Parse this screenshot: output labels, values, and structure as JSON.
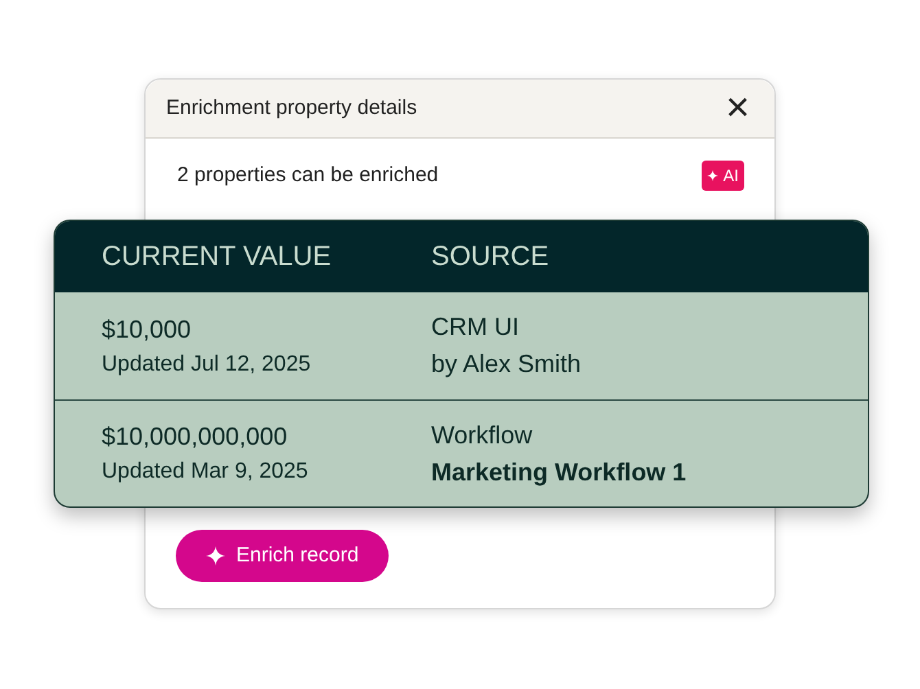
{
  "dialog": {
    "title": "Enrichment property details",
    "close": "×"
  },
  "summary": {
    "text": "2 properties can be enriched",
    "badge": "AI"
  },
  "table": {
    "columns": [
      "CURRENT VALUE",
      "SOURCE"
    ],
    "rows": [
      {
        "value": "$10,000",
        "updated": "Updated Jul 12, 2025",
        "source": "CRM UI",
        "source_detail": "by Alex Smith",
        "detail_bold": false
      },
      {
        "value": "$10,000,000,000",
        "updated": "Updated Mar 9, 2025",
        "source": "Workflow",
        "source_detail": "Marketing Workflow 1",
        "detail_bold": true
      }
    ]
  },
  "button": {
    "label": "Enrich record"
  }
}
